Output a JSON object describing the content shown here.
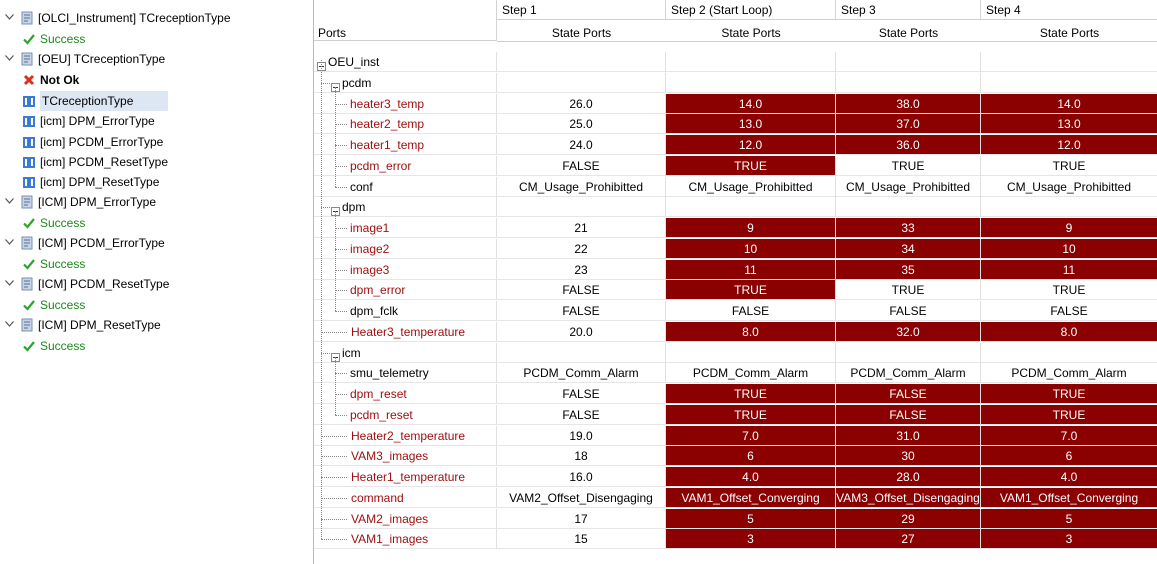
{
  "tree": {
    "nodes": [
      {
        "label": "[OLCI_Instrument] TCreceptionType",
        "kind": "test"
      },
      {
        "label": "Success",
        "kind": "success"
      },
      {
        "label": "[OEU] TCreceptionType",
        "kind": "test"
      },
      {
        "label": "Not Ok",
        "kind": "notok"
      },
      {
        "label": "TCreceptionType",
        "kind": "type"
      },
      {
        "label": "[icm] DPM_ErrorType",
        "kind": "type"
      },
      {
        "label": "[icm] PCDM_ErrorType",
        "kind": "type"
      },
      {
        "label": "[icm] PCDM_ResetType",
        "kind": "type"
      },
      {
        "label": "[icm] DPM_ResetType",
        "kind": "type"
      },
      {
        "label": "[ICM] DPM_ErrorType",
        "kind": "test"
      },
      {
        "label": "Success",
        "kind": "success"
      },
      {
        "label": "[ICM] PCDM_ErrorType",
        "kind": "test"
      },
      {
        "label": "Success",
        "kind": "success"
      },
      {
        "label": "[ICM] PCDM_ResetType",
        "kind": "test"
      },
      {
        "label": "Success",
        "kind": "success"
      },
      {
        "label": "[ICM] DPM_ResetType",
        "kind": "test"
      },
      {
        "label": "Success",
        "kind": "success"
      }
    ]
  },
  "grid": {
    "ports_header": "Ports",
    "steps": [
      "Step 1",
      "Step 2 (Start Loop)",
      "Step 3",
      "Step 4"
    ],
    "sub_header": "State Ports",
    "rows": [
      {
        "name": "OEU_inst",
        "kind": "group",
        "values": [
          "",
          "",
          "",
          ""
        ],
        "red": [
          false,
          false,
          false,
          false
        ]
      },
      {
        "name": "pcdm",
        "kind": "group",
        "values": [
          "",
          "",
          "",
          ""
        ],
        "red": [
          false,
          false,
          false,
          false
        ]
      },
      {
        "name": "heater3_temp",
        "kind": "red",
        "values": [
          "26.0",
          "14.0",
          "38.0",
          "14.0"
        ],
        "red": [
          false,
          true,
          true,
          true
        ]
      },
      {
        "name": "heater2_temp",
        "kind": "red",
        "values": [
          "25.0",
          "13.0",
          "37.0",
          "13.0"
        ],
        "red": [
          false,
          true,
          true,
          true
        ]
      },
      {
        "name": "heater1_temp",
        "kind": "red",
        "values": [
          "24.0",
          "12.0",
          "36.0",
          "12.0"
        ],
        "red": [
          false,
          true,
          true,
          true
        ]
      },
      {
        "name": "pcdm_error",
        "kind": "red",
        "values": [
          "FALSE",
          "TRUE",
          "TRUE",
          "TRUE"
        ],
        "red": [
          false,
          true,
          false,
          false
        ]
      },
      {
        "name": "conf",
        "kind": "blk",
        "values": [
          "CM_Usage_Prohibitted",
          "CM_Usage_Prohibitted",
          "CM_Usage_Prohibitted",
          "CM_Usage_Prohibitted"
        ],
        "red": [
          false,
          false,
          false,
          false
        ]
      },
      {
        "name": "dpm",
        "kind": "group",
        "values": [
          "",
          "",
          "",
          ""
        ],
        "red": [
          false,
          false,
          false,
          false
        ]
      },
      {
        "name": "image1",
        "kind": "red",
        "values": [
          "21",
          "9",
          "33",
          "9"
        ],
        "red": [
          false,
          true,
          true,
          true
        ]
      },
      {
        "name": "image2",
        "kind": "red",
        "values": [
          "22",
          "10",
          "34",
          "10"
        ],
        "red": [
          false,
          true,
          true,
          true
        ]
      },
      {
        "name": "image3",
        "kind": "red",
        "values": [
          "23",
          "11",
          "35",
          "11"
        ],
        "red": [
          false,
          true,
          true,
          true
        ]
      },
      {
        "name": "dpm_error",
        "kind": "red",
        "values": [
          "FALSE",
          "TRUE",
          "TRUE",
          "TRUE"
        ],
        "red": [
          false,
          true,
          false,
          false
        ]
      },
      {
        "name": "dpm_fclk",
        "kind": "blk",
        "values": [
          "FALSE",
          "FALSE",
          "FALSE",
          "FALSE"
        ],
        "red": [
          false,
          false,
          false,
          false
        ]
      },
      {
        "name": "Heater3_temperature",
        "kind": "red",
        "values": [
          "20.0",
          "8.0",
          "32.0",
          "8.0"
        ],
        "red": [
          false,
          true,
          true,
          true
        ]
      },
      {
        "name": "icm",
        "kind": "group",
        "values": [
          "",
          "",
          "",
          ""
        ],
        "red": [
          false,
          false,
          false,
          false
        ]
      },
      {
        "name": "smu_telemetry",
        "kind": "blk",
        "values": [
          "PCDM_Comm_Alarm",
          "PCDM_Comm_Alarm",
          "PCDM_Comm_Alarm",
          "PCDM_Comm_Alarm"
        ],
        "red": [
          false,
          false,
          false,
          false
        ]
      },
      {
        "name": "dpm_reset",
        "kind": "red",
        "values": [
          "FALSE",
          "TRUE",
          "FALSE",
          "TRUE"
        ],
        "red": [
          false,
          true,
          true,
          true
        ]
      },
      {
        "name": "pcdm_reset",
        "kind": "red",
        "values": [
          "FALSE",
          "TRUE",
          "FALSE",
          "TRUE"
        ],
        "red": [
          false,
          true,
          true,
          true
        ]
      },
      {
        "name": "Heater2_temperature",
        "kind": "red",
        "values": [
          "19.0",
          "7.0",
          "31.0",
          "7.0"
        ],
        "red": [
          false,
          true,
          true,
          true
        ]
      },
      {
        "name": "VAM3_images",
        "kind": "red",
        "values": [
          "18",
          "6",
          "30",
          "6"
        ],
        "red": [
          false,
          true,
          true,
          true
        ]
      },
      {
        "name": "Heater1_temperature",
        "kind": "red",
        "values": [
          "16.0",
          "4.0",
          "28.0",
          "4.0"
        ],
        "red": [
          false,
          true,
          true,
          true
        ]
      },
      {
        "name": "command",
        "kind": "red",
        "values": [
          "VAM2_Offset_Disengaging",
          "VAM1_Offset_Converging",
          "VAM3_Offset_Disengaging",
          "VAM1_Offset_Converging"
        ],
        "red": [
          false,
          true,
          true,
          true
        ]
      },
      {
        "name": "VAM2_images",
        "kind": "red",
        "values": [
          "17",
          "5",
          "29",
          "5"
        ],
        "red": [
          false,
          true,
          true,
          true
        ]
      },
      {
        "name": "VAM1_images",
        "kind": "red",
        "values": [
          "15",
          "3",
          "27",
          "3"
        ],
        "red": [
          false,
          true,
          true,
          true
        ]
      }
    ]
  }
}
